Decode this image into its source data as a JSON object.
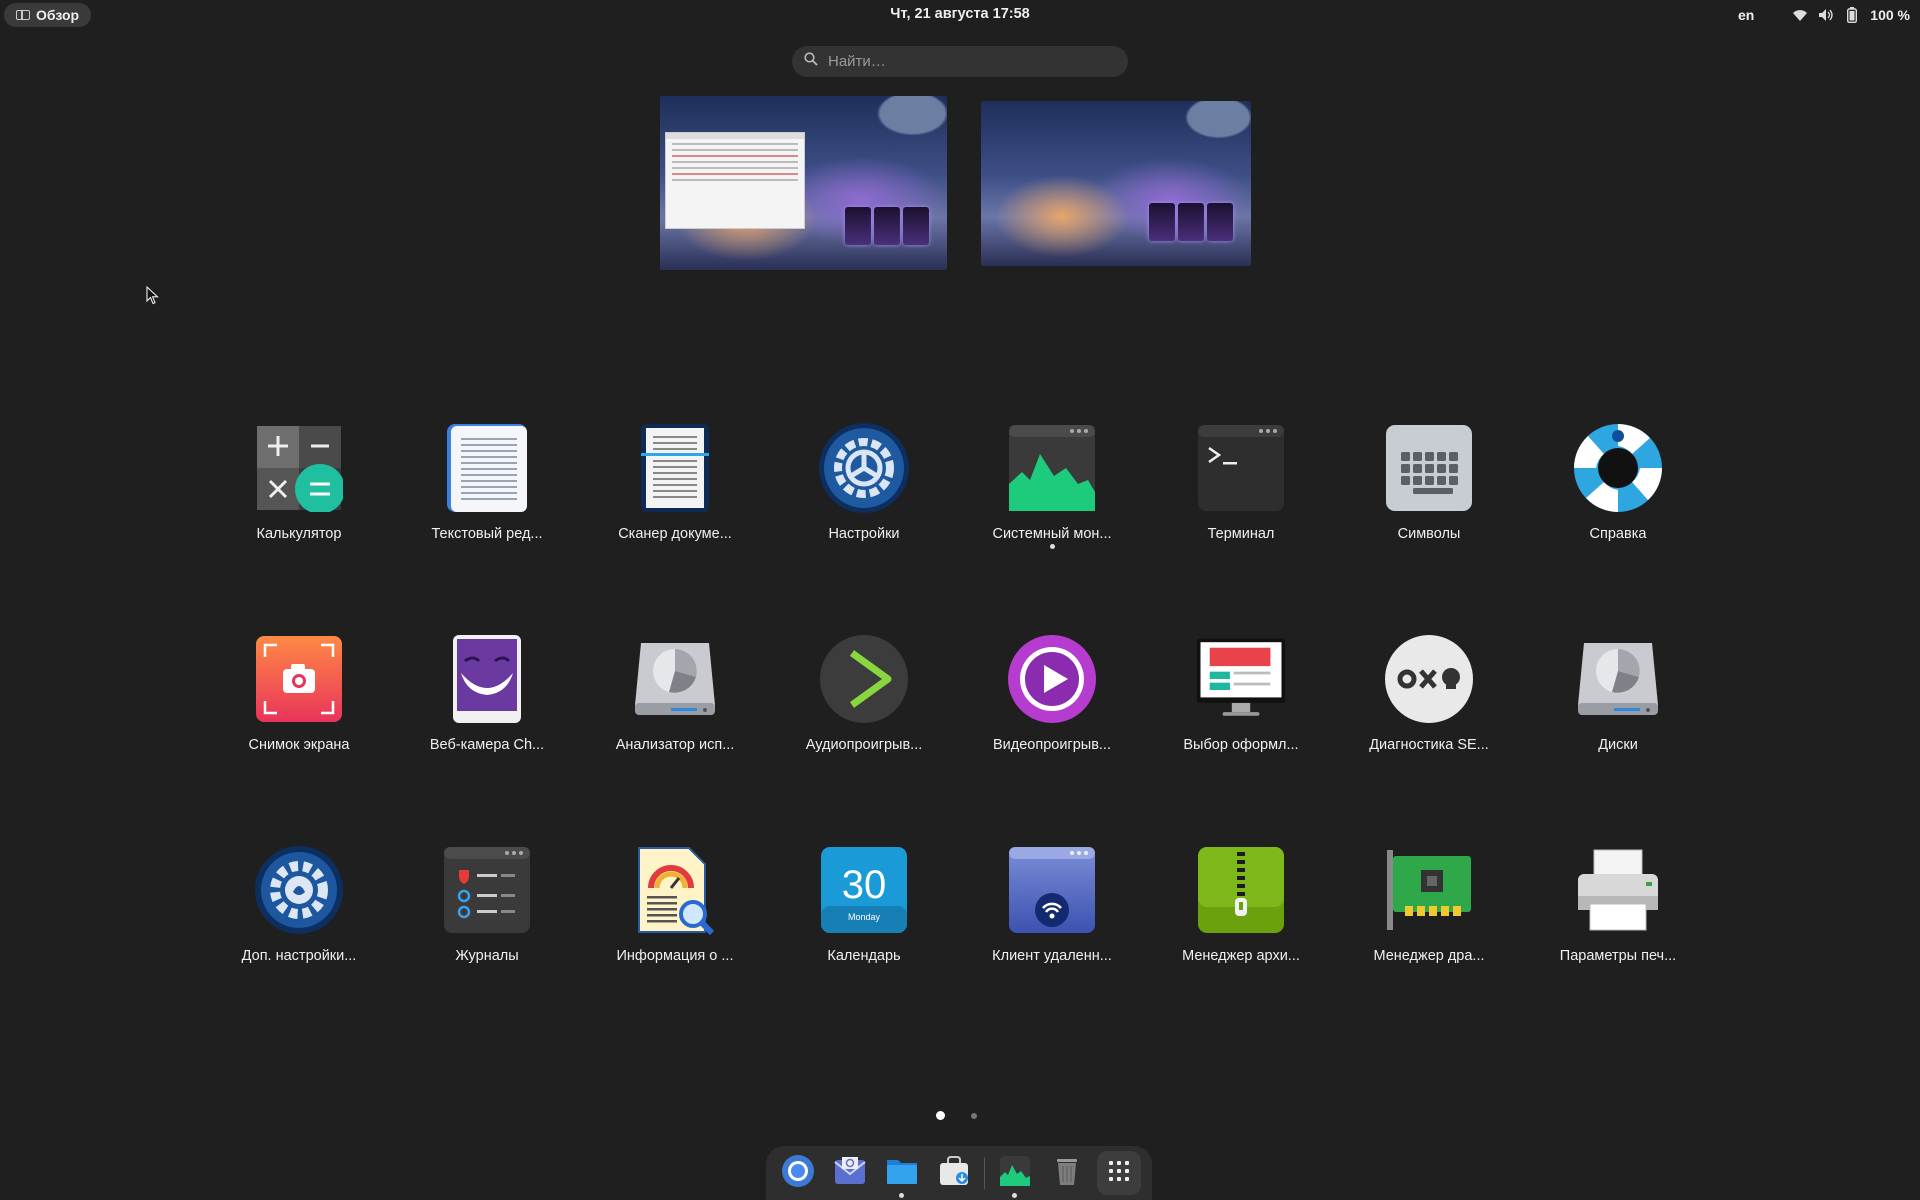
{
  "topbar": {
    "overview_label": "Обзор",
    "clock": "Чт, 21 августа  17:58",
    "lang": "en",
    "battery": "100 %",
    "tray_icons": [
      "wifi-icon",
      "volume-icon",
      "battery-icon"
    ]
  },
  "search": {
    "placeholder": "Найти…"
  },
  "apps": [
    {
      "label": "Калькулятор",
      "icon": "calculator-icon",
      "running": false
    },
    {
      "label": "Текстовый ред...",
      "icon": "text-editor-icon",
      "running": false
    },
    {
      "label": "Сканер докуме...",
      "icon": "document-scanner-icon",
      "running": false
    },
    {
      "label": "Настройки",
      "icon": "settings-icon",
      "running": false
    },
    {
      "label": "Системный мон...",
      "icon": "system-monitor-icon",
      "running": true
    },
    {
      "label": "Терминал",
      "icon": "terminal-icon",
      "running": false
    },
    {
      "label": "Символы",
      "icon": "characters-icon",
      "running": false
    },
    {
      "label": "Справка",
      "icon": "help-icon",
      "running": false
    },
    {
      "label": "Снимок экрана",
      "icon": "screenshot-icon",
      "running": false
    },
    {
      "label": "Веб-камера Ch...",
      "icon": "webcam-icon",
      "running": false
    },
    {
      "label": "Анализатор исп...",
      "icon": "disk-usage-analyzer-icon",
      "running": false
    },
    {
      "label": "Аудиопроигрыв...",
      "icon": "audio-player-icon",
      "running": false
    },
    {
      "label": "Видеопроигрыв...",
      "icon": "video-player-icon",
      "running": false
    },
    {
      "label": "Выбор оформл...",
      "icon": "theme-picker-icon",
      "running": false
    },
    {
      "label": "Диагностика SE...",
      "icon": "selinux-diagnostics-icon",
      "running": false
    },
    {
      "label": "Диски",
      "icon": "disks-icon",
      "running": false
    },
    {
      "label": "Доп. настройки...",
      "icon": "tweaks-icon",
      "running": false
    },
    {
      "label": "Журналы",
      "icon": "logs-icon",
      "running": false
    },
    {
      "label": "Информация о ...",
      "icon": "system-info-icon",
      "running": false
    },
    {
      "label": "Календарь",
      "icon": "calendar-icon",
      "running": false
    },
    {
      "label": "Клиент удаленн...",
      "icon": "remote-desktop-icon",
      "running": false
    },
    {
      "label": "Менеджер архи...",
      "icon": "archive-manager-icon",
      "running": false
    },
    {
      "label": "Менеджер дра...",
      "icon": "driver-manager-icon",
      "running": false
    },
    {
      "label": "Параметры печ...",
      "icon": "printer-icon",
      "running": false
    }
  ],
  "calendar_icon": {
    "day": "30",
    "weekday": "Monday"
  },
  "pager": {
    "pages": 2,
    "current": 1
  },
  "dock": [
    {
      "icon": "chromium-icon",
      "running": false
    },
    {
      "icon": "mail-icon",
      "running": false
    },
    {
      "icon": "files-icon",
      "running": true
    },
    {
      "icon": "software-center-icon",
      "running": false
    },
    {
      "icon": "system-monitor-icon",
      "running": true
    },
    {
      "icon": "trash-icon",
      "running": false
    },
    {
      "icon": "app-grid-icon",
      "running": false
    }
  ]
}
